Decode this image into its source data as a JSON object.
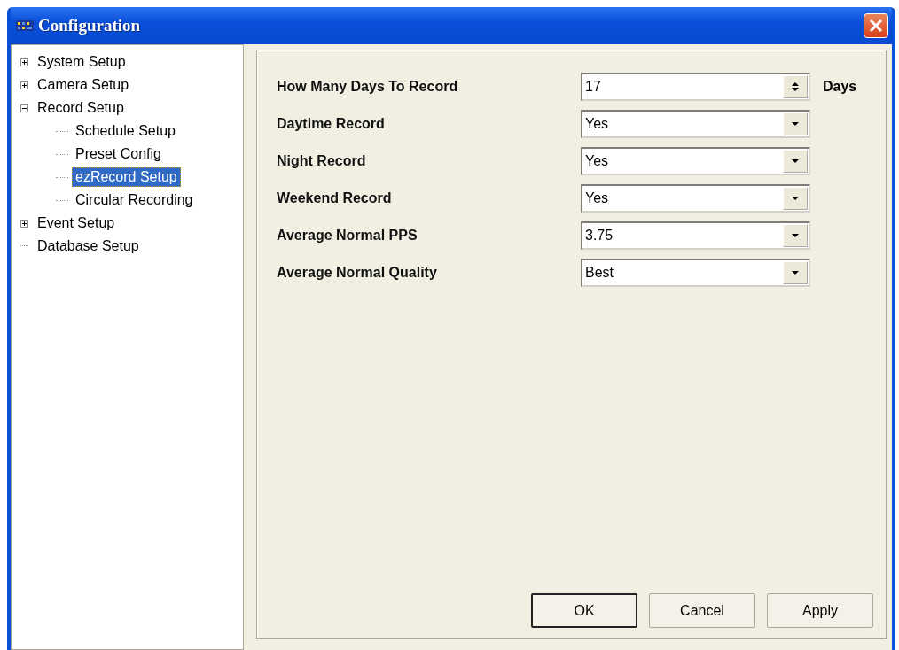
{
  "window": {
    "title": "Configuration"
  },
  "tree": [
    {
      "label": "System Setup",
      "expanded": false,
      "selected": false
    },
    {
      "label": "Camera Setup",
      "expanded": false,
      "selected": false
    },
    {
      "label": "Record Setup",
      "expanded": true,
      "selected": false,
      "children": [
        {
          "label": "Schedule Setup",
          "selected": false
        },
        {
          "label": "Preset Config",
          "selected": false
        },
        {
          "label": "ezRecord Setup",
          "selected": true
        },
        {
          "label": "Circular Recording",
          "selected": false
        }
      ]
    },
    {
      "label": "Event Setup",
      "expanded": false,
      "selected": false
    },
    {
      "label": "Database Setup",
      "selected": false
    }
  ],
  "form": [
    {
      "label": "How Many Days To Record",
      "kind": "spin",
      "value": "17",
      "unit": "Days"
    },
    {
      "label": "Daytime Record",
      "kind": "dropdown",
      "value": "Yes"
    },
    {
      "label": "Night Record",
      "kind": "dropdown",
      "value": "Yes"
    },
    {
      "label": "Weekend Record",
      "kind": "dropdown",
      "value": "Yes"
    },
    {
      "label": "Average Normal PPS",
      "kind": "dropdown",
      "value": "3.75"
    },
    {
      "label": "Average Normal Quality",
      "kind": "dropdown",
      "value": "Best"
    }
  ],
  "buttons": [
    {
      "label": "OK",
      "default": true
    },
    {
      "label": "Cancel",
      "default": false
    },
    {
      "label": "Apply",
      "default": false
    }
  ]
}
